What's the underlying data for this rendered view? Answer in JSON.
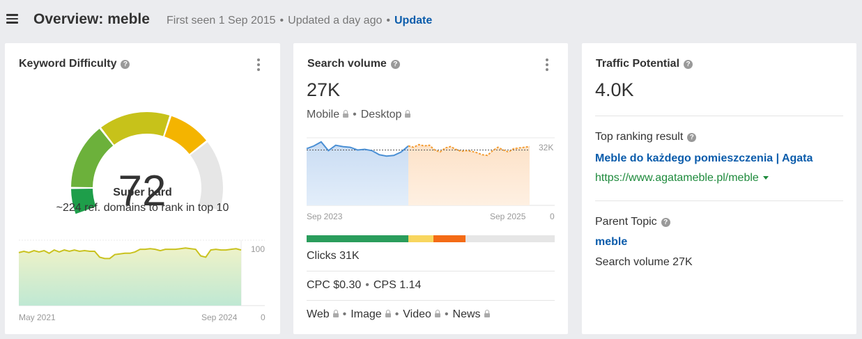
{
  "header": {
    "title": "Overview: meble",
    "first_seen": "First seen 1 Sep 2015",
    "updated": "Updated a day ago",
    "update_link": "Update"
  },
  "kd": {
    "title": "Keyword Difficulty",
    "value": "72",
    "label": "Super hard",
    "note": "~224 ref. domains to rank in top 10",
    "chart": {
      "x_start": "May 2021",
      "x_end": "Sep 2024",
      "y_max": "100",
      "y_min": "0",
      "values": [
        81,
        83,
        81,
        84,
        82,
        84,
        80,
        85,
        82,
        85,
        83,
        85,
        83,
        84,
        83,
        83,
        74,
        72,
        72,
        78,
        79,
        80,
        80,
        82,
        86,
        86,
        87,
        86,
        84,
        86,
        86,
        86,
        87,
        88,
        87,
        86,
        76,
        74,
        85,
        86,
        85,
        85,
        86,
        87,
        85
      ]
    },
    "gauge_colors": [
      "#1e9e4a",
      "#6cb13b",
      "#c7c21a",
      "#f4b400",
      "#e6e6e6"
    ]
  },
  "sv": {
    "title": "Search volume",
    "value": "27K",
    "mobile": "Mobile",
    "desktop": "Desktop",
    "chart": {
      "x_start": "Sep 2023",
      "x_end": "Sep 2025",
      "y_max": "32K",
      "y_min": "0",
      "reference_level": 0.82,
      "actual": [
        0.84,
        0.88,
        0.94,
        0.81,
        0.89,
        0.87,
        0.86,
        0.82,
        0.83,
        0.81,
        0.75,
        0.73,
        0.74,
        0.79,
        0.88
      ],
      "forecast": [
        0.88,
        0.86,
        0.9,
        0.88,
        0.89,
        0.82,
        0.79,
        0.85,
        0.87,
        0.83,
        0.8,
        0.81,
        0.8,
        0.78,
        0.75,
        0.74,
        0.81,
        0.86,
        0.82,
        0.79,
        0.84,
        0.85,
        0.86,
        0.87
      ],
      "actual_color": "#4a8fd4",
      "forecast_color": "#f39c34"
    },
    "bar_segments": [
      {
        "color": "#2a9d5c",
        "value": 0.41
      },
      {
        "color": "#f8d65f",
        "value": 0.1
      },
      {
        "color": "#f46b16",
        "value": 0.13
      },
      {
        "color": "#e6e6e6",
        "value": 0.36
      }
    ],
    "clicks": "Clicks 31K",
    "cpc": "CPC $0.30",
    "cps": "CPS 1.14",
    "serp_features": [
      "Web",
      "Image",
      "Video",
      "News"
    ]
  },
  "tp": {
    "title": "Traffic Potential",
    "value": "4.0K",
    "top_ranking_label": "Top ranking result",
    "result_title": "Meble do każdego pomieszczenia | Agata",
    "result_url": "https://www.agatameble.pl/meble",
    "parent_topic_label": "Parent Topic",
    "parent_topic": "meble",
    "parent_volume": "Search volume 27K"
  }
}
